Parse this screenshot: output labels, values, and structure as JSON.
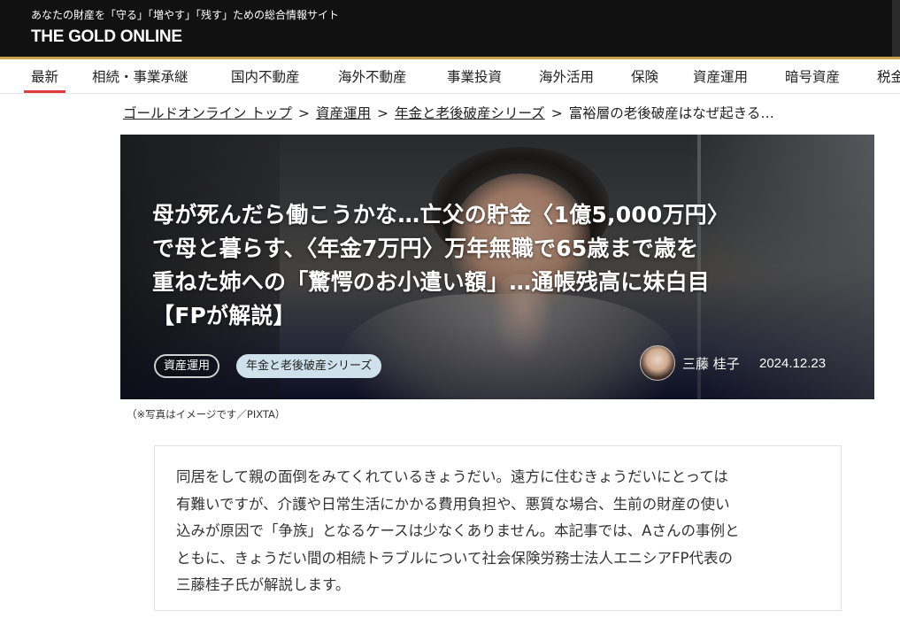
{
  "header": {
    "tagline": "あなたの財産を「守る」「増やす」「残す」ための総合情報サイト",
    "logo": "THE GOLD ONLINE"
  },
  "nav": {
    "items": [
      {
        "label": "最新",
        "active": true
      },
      {
        "label": "相続・事業承継"
      },
      {
        "label": "国内不動産"
      },
      {
        "label": "海外不動産"
      },
      {
        "label": "事業投資"
      },
      {
        "label": "海外活用"
      },
      {
        "label": "保険"
      },
      {
        "label": "資産運用"
      },
      {
        "label": "暗号資産"
      },
      {
        "label": "税金"
      }
    ]
  },
  "breadcrumb": {
    "items": [
      "ゴールドオンライン トップ",
      "資産運用",
      "年金と老後破産シリーズ"
    ],
    "current": "富裕層の老後破産はなぜ起きる…",
    "separator": ">"
  },
  "hero": {
    "title_lines": [
      "母が死んだら働こうかな…亡父の貯金〈1億5,000万円〉",
      "で母と暮らす、〈年金7万円〉万年無職で65歳まで歳を",
      "重ねた姉への「驚愕のお小遣い額」…通帳残高に妹白目",
      "【FPが解説】"
    ],
    "tags": [
      "資産運用",
      "年金と老後破産シリーズ"
    ],
    "author": "三藤 桂子",
    "date": "2024.12.23"
  },
  "photo_caption": "（※写真はイメージです／PIXTA）",
  "summary": {
    "lines": [
      "同居をして親の面倒をみてくれているきょうだい。遠方に住むきょうだいにとっては",
      "有難いですが、介護や日常生活にかかる費用負担や、悪質な場合、生前の財産の使い",
      "込みが原因で「争族」となるケースは少なくありません。本記事では、Aさんの事例と",
      "ともに、きょうだい間の相続トラブルについて社会保険労務士法人エニシアFP代表の",
      "三藤桂子氏が解説します。"
    ]
  },
  "colors": {
    "header_bg": "#111111",
    "gold_accent": "#c8a24a",
    "active_underline": "#e03a3a",
    "tag_filled_bg": "#cfe2ec"
  }
}
